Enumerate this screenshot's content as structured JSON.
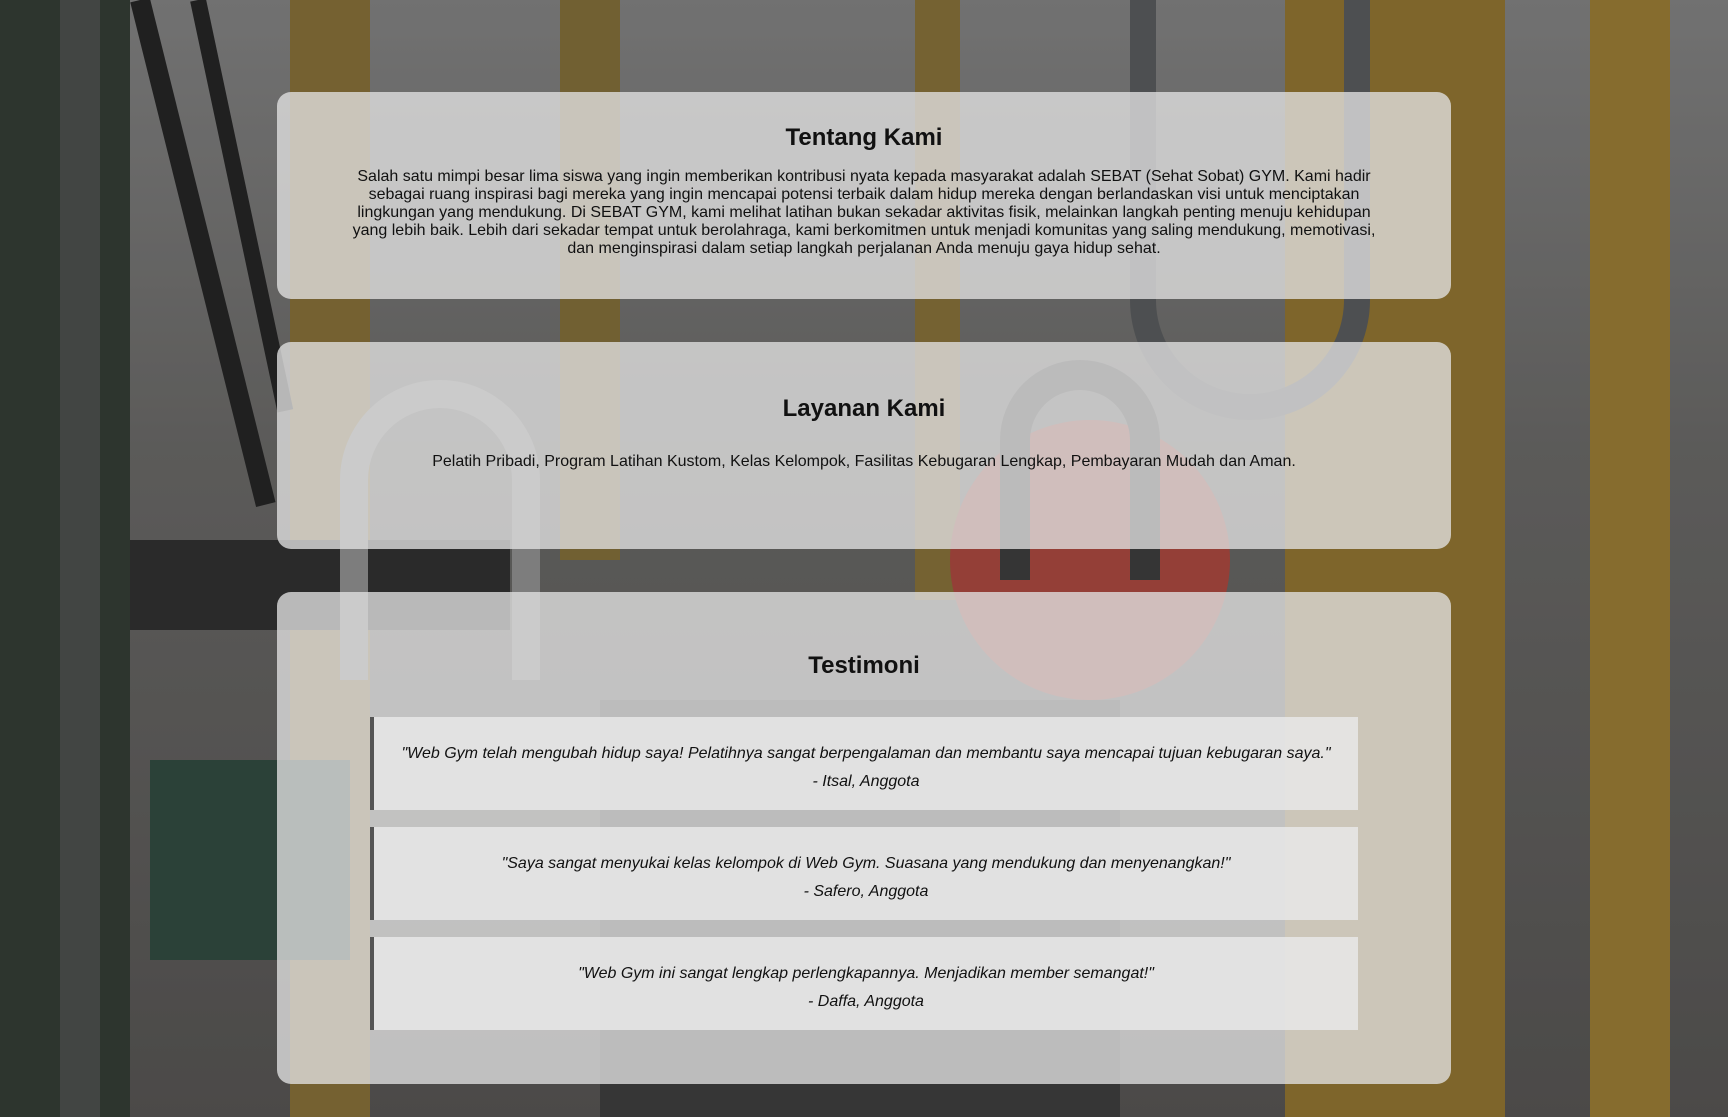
{
  "about": {
    "title": "Tentang Kami",
    "body": "Salah satu mimpi besar lima siswa yang ingin memberikan kontribusi nyata kepada masyarakat adalah SEBAT (Sehat Sobat) GYM. Kami hadir sebagai ruang inspirasi bagi mereka yang ingin mencapai potensi terbaik dalam hidup mereka dengan berlandaskan visi untuk menciptakan lingkungan yang mendukung. Di SEBAT GYM, kami melihat latihan bukan sekadar aktivitas fisik, melainkan langkah penting menuju kehidupan yang lebih baik. Lebih dari sekadar tempat untuk berolahraga, kami berkomitmen untuk menjadi komunitas yang saling mendukung, memotivasi, dan menginspirasi dalam setiap langkah perjalanan Anda menuju gaya hidup sehat."
  },
  "services": {
    "title": "Layanan Kami",
    "body": "Pelatih Pribadi, Program Latihan Kustom, Kelas Kelompok, Fasilitas Kebugaran Lengkap, Pembayaran Mudah dan Aman."
  },
  "testimonials": {
    "title": "Testimoni",
    "items": [
      {
        "quote": "\"Web Gym telah mengubah hidup saya! Pelatihnya sangat berpengalaman dan membantu saya mencapai tujuan kebugaran saya.\"",
        "author": "- Itsal, Anggota"
      },
      {
        "quote": "\"Saya sangat menyukai kelas kelompok di Web Gym. Suasana yang mendukung dan menyenangkan!\"",
        "author": "- Safero, Anggota"
      },
      {
        "quote": "\"Web Gym ini sangat lengkap perlengkapannya. Menjadikan member semangat!\"",
        "author": "- Daffa, Anggota"
      }
    ]
  },
  "background": {
    "subject": "gym kettlebell rack photo",
    "colors": {
      "frame": "#b08a33",
      "dark": "#2a2a2a",
      "kettlebell_red": "#b8473d",
      "steel": "#9a9a9a"
    }
  }
}
